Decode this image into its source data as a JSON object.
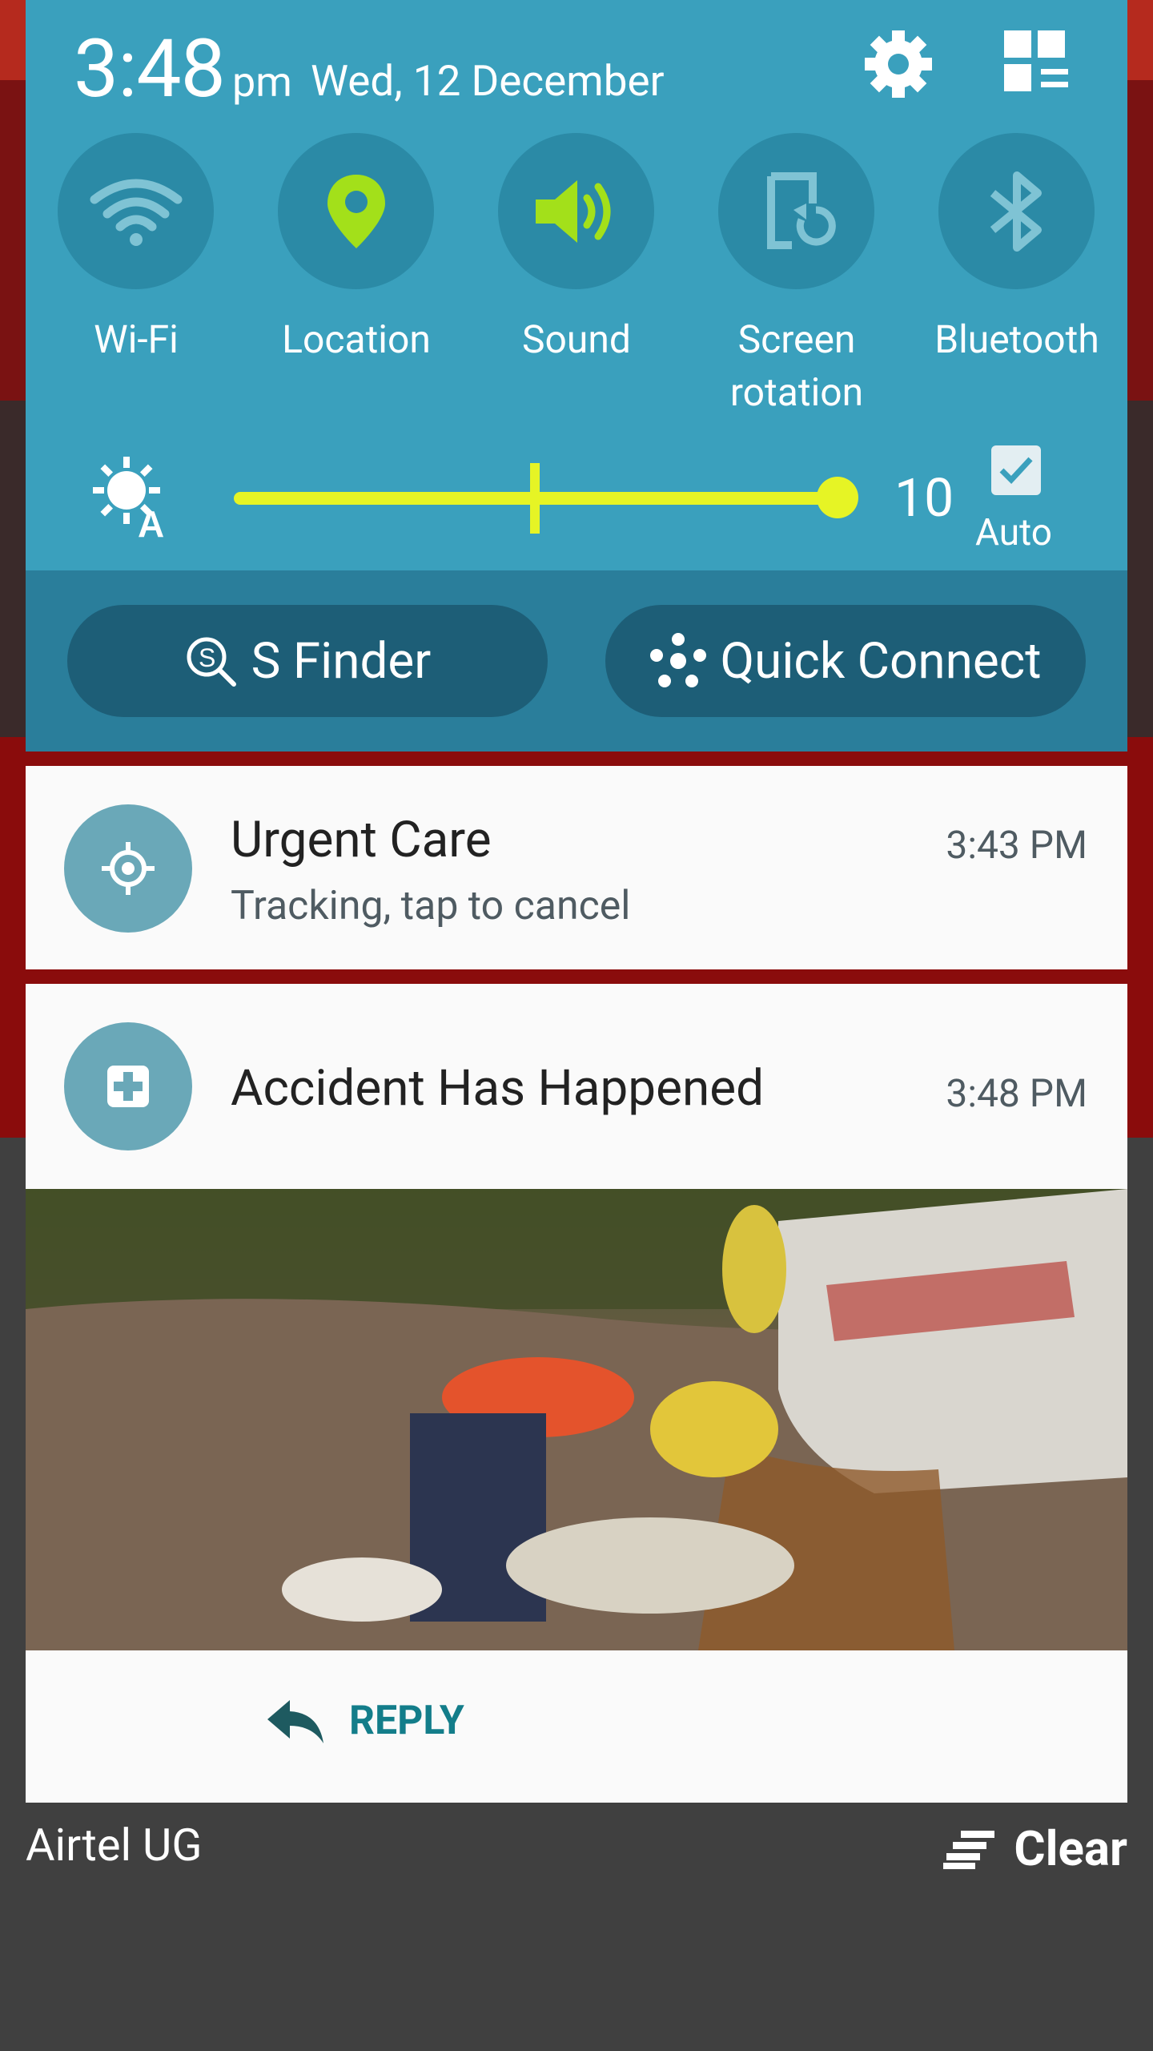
{
  "status": {
    "time": "3:48",
    "ampm": "pm",
    "date": "Wed, 12 December"
  },
  "toggles": [
    {
      "label": "Wi-Fi",
      "icon": "wifi-icon",
      "active": false
    },
    {
      "label": "Location",
      "icon": "location-pin-icon",
      "active": true
    },
    {
      "label": "Sound",
      "icon": "speaker-icon",
      "active": true
    },
    {
      "label": "Screen rotation",
      "icon": "screen-rotation-icon",
      "active": false
    },
    {
      "label": "Bluetooth",
      "icon": "bluetooth-icon",
      "active": false
    }
  ],
  "brightness": {
    "value": "10",
    "level": 1.0,
    "auto_label": "Auto",
    "auto_checked": true
  },
  "actions": {
    "s_finder": "S Finder",
    "quick_connect": "Quick Connect"
  },
  "notifications": [
    {
      "title": "Urgent Care",
      "subtitle": "Tracking, tap to cancel",
      "time": "3:43 PM",
      "icon": "crosshair-icon"
    },
    {
      "title": "Accident Has Happened",
      "time": "3:48 PM",
      "icon": "medical-cross-icon",
      "reply_label": "REPLY"
    }
  ],
  "footer": {
    "carrier": "Airtel UG",
    "clear_label": "Clear"
  },
  "colors": {
    "panel": "#3aa0bd",
    "panel_dark": "#2a7e9b",
    "accent": "#a3e01a",
    "slider": "#e6f425",
    "reply": "#137d8a"
  }
}
